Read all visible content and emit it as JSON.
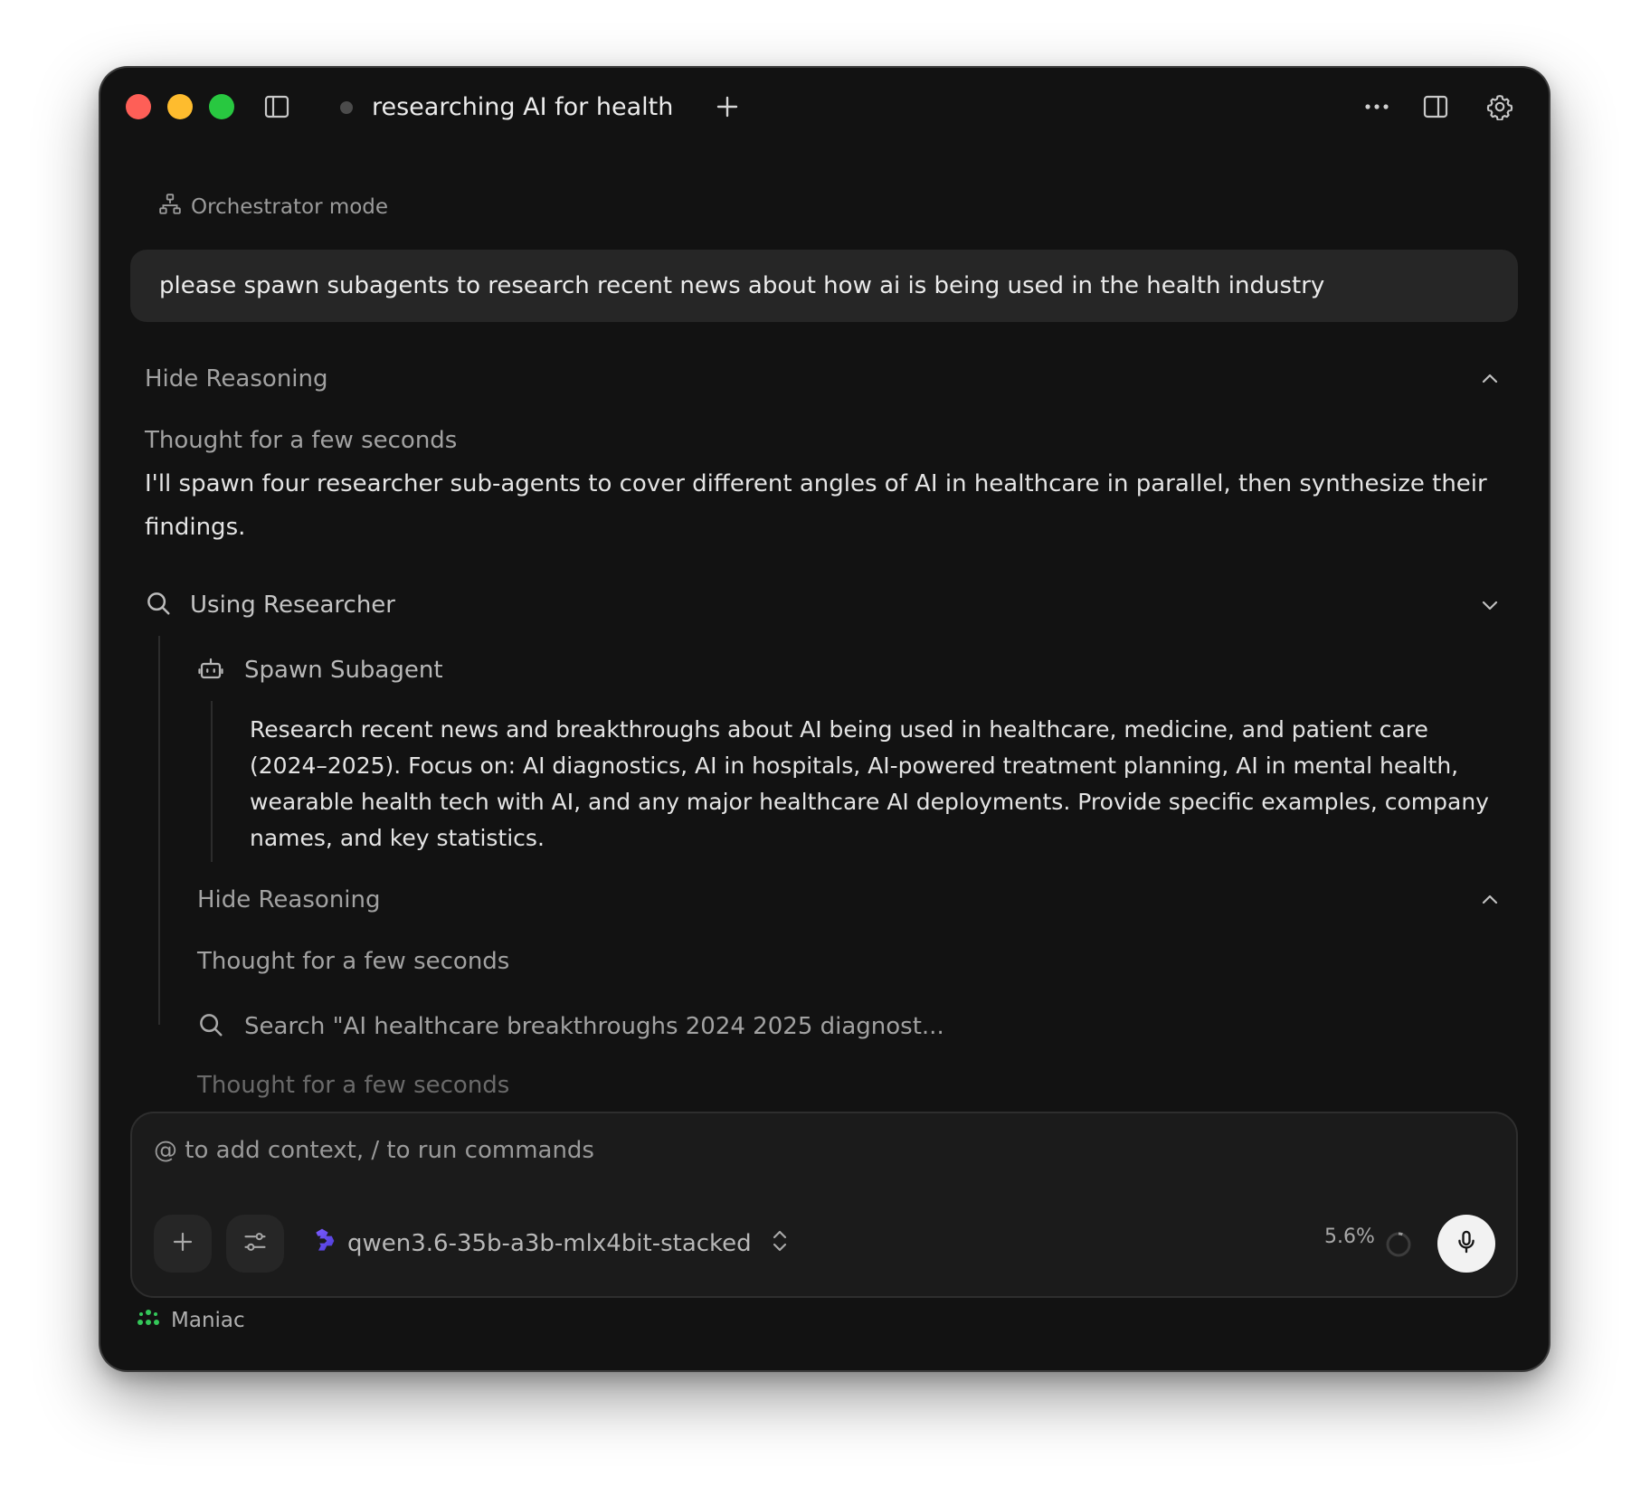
{
  "window": {
    "tab_title": "researching AI for health"
  },
  "mode_label": "Orchestrator mode",
  "user_message": "please spawn subagents to research recent news about how ai is being used in the health industry",
  "reasoning": {
    "toggle_label": "Hide Reasoning",
    "thought_label": "Thought for a few seconds",
    "response_text": "I'll spawn four researcher sub-agents to cover different angles of AI in healthcare in parallel, then synthesize their findings."
  },
  "tool_use": {
    "label": "Using Researcher",
    "subagent_label": "Spawn Subagent",
    "subagent_prompt": "Research recent news and breakthroughs about AI being used in healthcare, medicine, and patient care (2024–2025). Focus on: AI diagnostics, AI in hospitals, AI-powered treatment planning, AI in mental health, wearable health tech with AI, and any major healthcare AI deployments. Provide specific examples, company names, and key statistics.",
    "inner_toggle_label": "Hide Reasoning",
    "inner_thought_label": "Thought for a few seconds",
    "search_label": "Search \"AI healthcare breakthroughs 2024 2025 diagnost...",
    "trailing_thought_label": "Thought for a few seconds"
  },
  "composer": {
    "placeholder": "@ to add context, / to run commands",
    "model_name": "qwen3.6-35b-a3b-mlx4bit-stacked",
    "context_usage": "5.6%"
  },
  "footer": {
    "brand_label": "Maniac",
    "brand_color": "#34c759"
  },
  "colors": {
    "window_bg": "#121212",
    "close": "#fe5f57",
    "minimize": "#febc2e",
    "maximize": "#28c840"
  }
}
